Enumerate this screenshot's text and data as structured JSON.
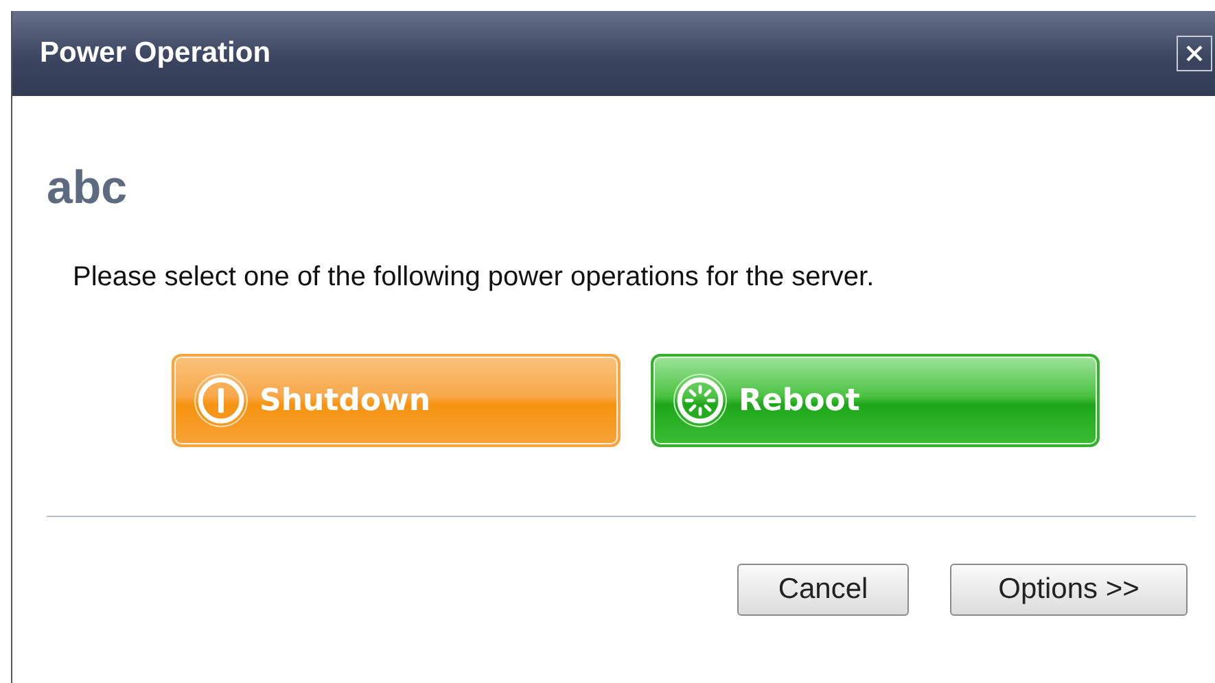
{
  "window": {
    "title": "Power Operation"
  },
  "heading": "abc",
  "message": "Please select one of the following power operations for the server.",
  "actions": [
    {
      "label": "Shutdown",
      "kind": "shutdown"
    },
    {
      "label": "Reboot",
      "kind": "reboot"
    }
  ],
  "buttons": [
    "Cancel",
    "Options >>"
  ]
}
